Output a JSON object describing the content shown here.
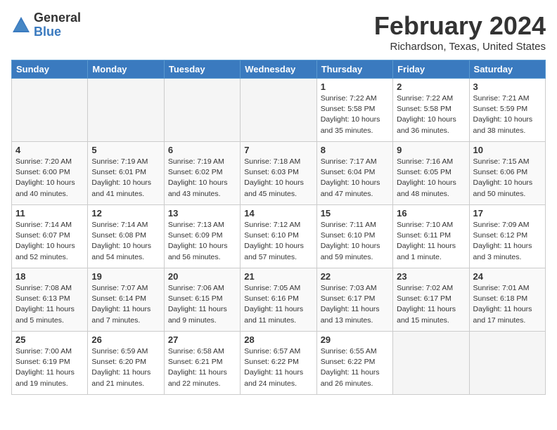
{
  "logo": {
    "general": "General",
    "blue": "Blue"
  },
  "title": "February 2024",
  "subtitle": "Richardson, Texas, United States",
  "days_of_week": [
    "Sunday",
    "Monday",
    "Tuesday",
    "Wednesday",
    "Thursday",
    "Friday",
    "Saturday"
  ],
  "weeks": [
    [
      {
        "day": "",
        "info": ""
      },
      {
        "day": "",
        "info": ""
      },
      {
        "day": "",
        "info": ""
      },
      {
        "day": "",
        "info": ""
      },
      {
        "day": "1",
        "info": "Sunrise: 7:22 AM\nSunset: 5:58 PM\nDaylight: 10 hours\nand 35 minutes."
      },
      {
        "day": "2",
        "info": "Sunrise: 7:22 AM\nSunset: 5:58 PM\nDaylight: 10 hours\nand 36 minutes."
      },
      {
        "day": "3",
        "info": "Sunrise: 7:21 AM\nSunset: 5:59 PM\nDaylight: 10 hours\nand 38 minutes."
      }
    ],
    [
      {
        "day": "4",
        "info": "Sunrise: 7:20 AM\nSunset: 6:00 PM\nDaylight: 10 hours\nand 40 minutes."
      },
      {
        "day": "5",
        "info": "Sunrise: 7:19 AM\nSunset: 6:01 PM\nDaylight: 10 hours\nand 41 minutes."
      },
      {
        "day": "6",
        "info": "Sunrise: 7:19 AM\nSunset: 6:02 PM\nDaylight: 10 hours\nand 43 minutes."
      },
      {
        "day": "7",
        "info": "Sunrise: 7:18 AM\nSunset: 6:03 PM\nDaylight: 10 hours\nand 45 minutes."
      },
      {
        "day": "8",
        "info": "Sunrise: 7:17 AM\nSunset: 6:04 PM\nDaylight: 10 hours\nand 47 minutes."
      },
      {
        "day": "9",
        "info": "Sunrise: 7:16 AM\nSunset: 6:05 PM\nDaylight: 10 hours\nand 48 minutes."
      },
      {
        "day": "10",
        "info": "Sunrise: 7:15 AM\nSunset: 6:06 PM\nDaylight: 10 hours\nand 50 minutes."
      }
    ],
    [
      {
        "day": "11",
        "info": "Sunrise: 7:14 AM\nSunset: 6:07 PM\nDaylight: 10 hours\nand 52 minutes."
      },
      {
        "day": "12",
        "info": "Sunrise: 7:14 AM\nSunset: 6:08 PM\nDaylight: 10 hours\nand 54 minutes."
      },
      {
        "day": "13",
        "info": "Sunrise: 7:13 AM\nSunset: 6:09 PM\nDaylight: 10 hours\nand 56 minutes."
      },
      {
        "day": "14",
        "info": "Sunrise: 7:12 AM\nSunset: 6:10 PM\nDaylight: 10 hours\nand 57 minutes."
      },
      {
        "day": "15",
        "info": "Sunrise: 7:11 AM\nSunset: 6:10 PM\nDaylight: 10 hours\nand 59 minutes."
      },
      {
        "day": "16",
        "info": "Sunrise: 7:10 AM\nSunset: 6:11 PM\nDaylight: 11 hours\nand 1 minute."
      },
      {
        "day": "17",
        "info": "Sunrise: 7:09 AM\nSunset: 6:12 PM\nDaylight: 11 hours\nand 3 minutes."
      }
    ],
    [
      {
        "day": "18",
        "info": "Sunrise: 7:08 AM\nSunset: 6:13 PM\nDaylight: 11 hours\nand 5 minutes."
      },
      {
        "day": "19",
        "info": "Sunrise: 7:07 AM\nSunset: 6:14 PM\nDaylight: 11 hours\nand 7 minutes."
      },
      {
        "day": "20",
        "info": "Sunrise: 7:06 AM\nSunset: 6:15 PM\nDaylight: 11 hours\nand 9 minutes."
      },
      {
        "day": "21",
        "info": "Sunrise: 7:05 AM\nSunset: 6:16 PM\nDaylight: 11 hours\nand 11 minutes."
      },
      {
        "day": "22",
        "info": "Sunrise: 7:03 AM\nSunset: 6:17 PM\nDaylight: 11 hours\nand 13 minutes."
      },
      {
        "day": "23",
        "info": "Sunrise: 7:02 AM\nSunset: 6:17 PM\nDaylight: 11 hours\nand 15 minutes."
      },
      {
        "day": "24",
        "info": "Sunrise: 7:01 AM\nSunset: 6:18 PM\nDaylight: 11 hours\nand 17 minutes."
      }
    ],
    [
      {
        "day": "25",
        "info": "Sunrise: 7:00 AM\nSunset: 6:19 PM\nDaylight: 11 hours\nand 19 minutes."
      },
      {
        "day": "26",
        "info": "Sunrise: 6:59 AM\nSunset: 6:20 PM\nDaylight: 11 hours\nand 21 minutes."
      },
      {
        "day": "27",
        "info": "Sunrise: 6:58 AM\nSunset: 6:21 PM\nDaylight: 11 hours\nand 22 minutes."
      },
      {
        "day": "28",
        "info": "Sunrise: 6:57 AM\nSunset: 6:22 PM\nDaylight: 11 hours\nand 24 minutes."
      },
      {
        "day": "29",
        "info": "Sunrise: 6:55 AM\nSunset: 6:22 PM\nDaylight: 11 hours\nand 26 minutes."
      },
      {
        "day": "",
        "info": ""
      },
      {
        "day": "",
        "info": ""
      }
    ]
  ]
}
